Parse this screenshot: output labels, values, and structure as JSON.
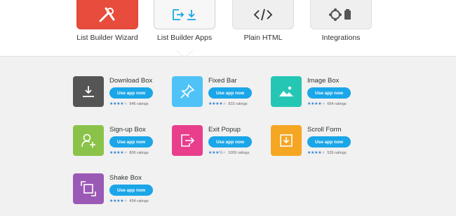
{
  "categories": [
    {
      "label": "List Builder Wizard",
      "icon": "tools-icon",
      "color": "#e74c3c"
    },
    {
      "label": "List Builder Apps",
      "icon": "apps-export-download-icon",
      "color": "#1aa6e8"
    },
    {
      "label": "Plain HTML",
      "icon": "code-icon",
      "color": "#333333"
    },
    {
      "label": "Integrations",
      "icon": "joomla-icon",
      "color": "#333333"
    }
  ],
  "selected_category": "List Builder Apps",
  "apps": [
    {
      "name": "Download Box",
      "button": "Use app now",
      "ratings": "946 ratings",
      "stars": 4,
      "color": "#555555",
      "icon": "download-icon"
    },
    {
      "name": "Fixed Bar",
      "button": "Use app now",
      "ratings": "815 ratings",
      "stars": 4,
      "color": "#4fc3f7",
      "icon": "pin-icon"
    },
    {
      "name": "Image Box",
      "button": "Use app now",
      "ratings": "664 ratings",
      "stars": 4,
      "color": "#26c6b5",
      "icon": "image-icon"
    },
    {
      "name": "Sign-up Box",
      "button": "Use app now",
      "ratings": "806 ratings",
      "stars": 4,
      "color": "#8bc34a",
      "icon": "add-user-icon"
    },
    {
      "name": "Exit Popup",
      "button": "Use app now",
      "ratings": "1009 ratings",
      "stars": 3.5,
      "color": "#e83e8c",
      "icon": "exit-icon"
    },
    {
      "name": "Scroll Form",
      "button": "Use app now",
      "ratings": "526 ratings",
      "stars": 4,
      "color": "#f5a623",
      "icon": "scroll-down-icon"
    },
    {
      "name": "Shake Box",
      "button": "Use app now",
      "ratings": "434 ratings",
      "stars": 4,
      "color": "#9b59b6",
      "icon": "shake-icon"
    }
  ]
}
